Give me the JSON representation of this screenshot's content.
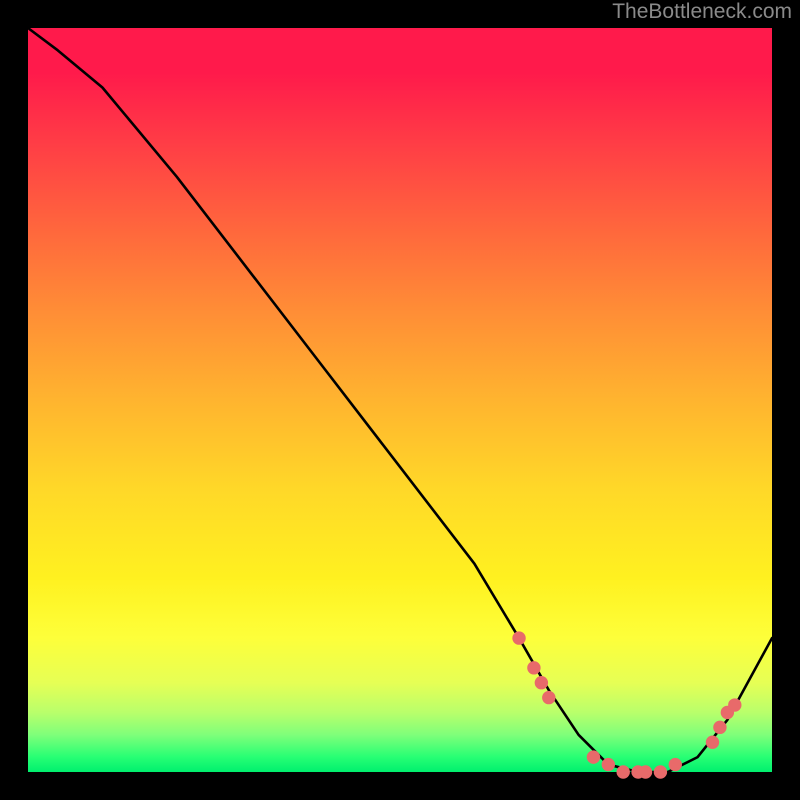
{
  "watermark": "TheBottleneck.com",
  "chart_data": {
    "type": "line",
    "title": "",
    "xlabel": "",
    "ylabel": "",
    "xlim": [
      0,
      100
    ],
    "ylim": [
      0,
      100
    ],
    "grid": false,
    "legend": false,
    "series": [
      {
        "name": "curve",
        "x": [
          0,
          4,
          10,
          20,
          30,
          40,
          50,
          60,
          66,
          70,
          74,
          78,
          82,
          86,
          90,
          94,
          100
        ],
        "y": [
          100,
          97,
          92,
          80,
          67,
          54,
          41,
          28,
          18,
          11,
          5,
          1,
          0,
          0,
          2,
          7,
          18
        ]
      }
    ],
    "markers": [
      {
        "name": "left-cluster-1",
        "x": 66,
        "y": 18
      },
      {
        "name": "left-cluster-2",
        "x": 68,
        "y": 14
      },
      {
        "name": "left-cluster-3",
        "x": 69,
        "y": 12
      },
      {
        "name": "left-cluster-4",
        "x": 70,
        "y": 10
      },
      {
        "name": "bottom-1",
        "x": 76,
        "y": 2
      },
      {
        "name": "bottom-2",
        "x": 78,
        "y": 1
      },
      {
        "name": "bottom-3",
        "x": 80,
        "y": 0
      },
      {
        "name": "bottom-4",
        "x": 82,
        "y": 0
      },
      {
        "name": "bottom-5",
        "x": 83,
        "y": 0
      },
      {
        "name": "bottom-6",
        "x": 85,
        "y": 0
      },
      {
        "name": "bottom-7",
        "x": 87,
        "y": 1
      },
      {
        "name": "right-cluster-1",
        "x": 92,
        "y": 4
      },
      {
        "name": "right-cluster-2",
        "x": 93,
        "y": 6
      },
      {
        "name": "right-cluster-3",
        "x": 94,
        "y": 8
      },
      {
        "name": "right-cluster-4",
        "x": 95,
        "y": 9
      }
    ],
    "marker_color": "#e86a6a",
    "curve_color": "#000000"
  }
}
